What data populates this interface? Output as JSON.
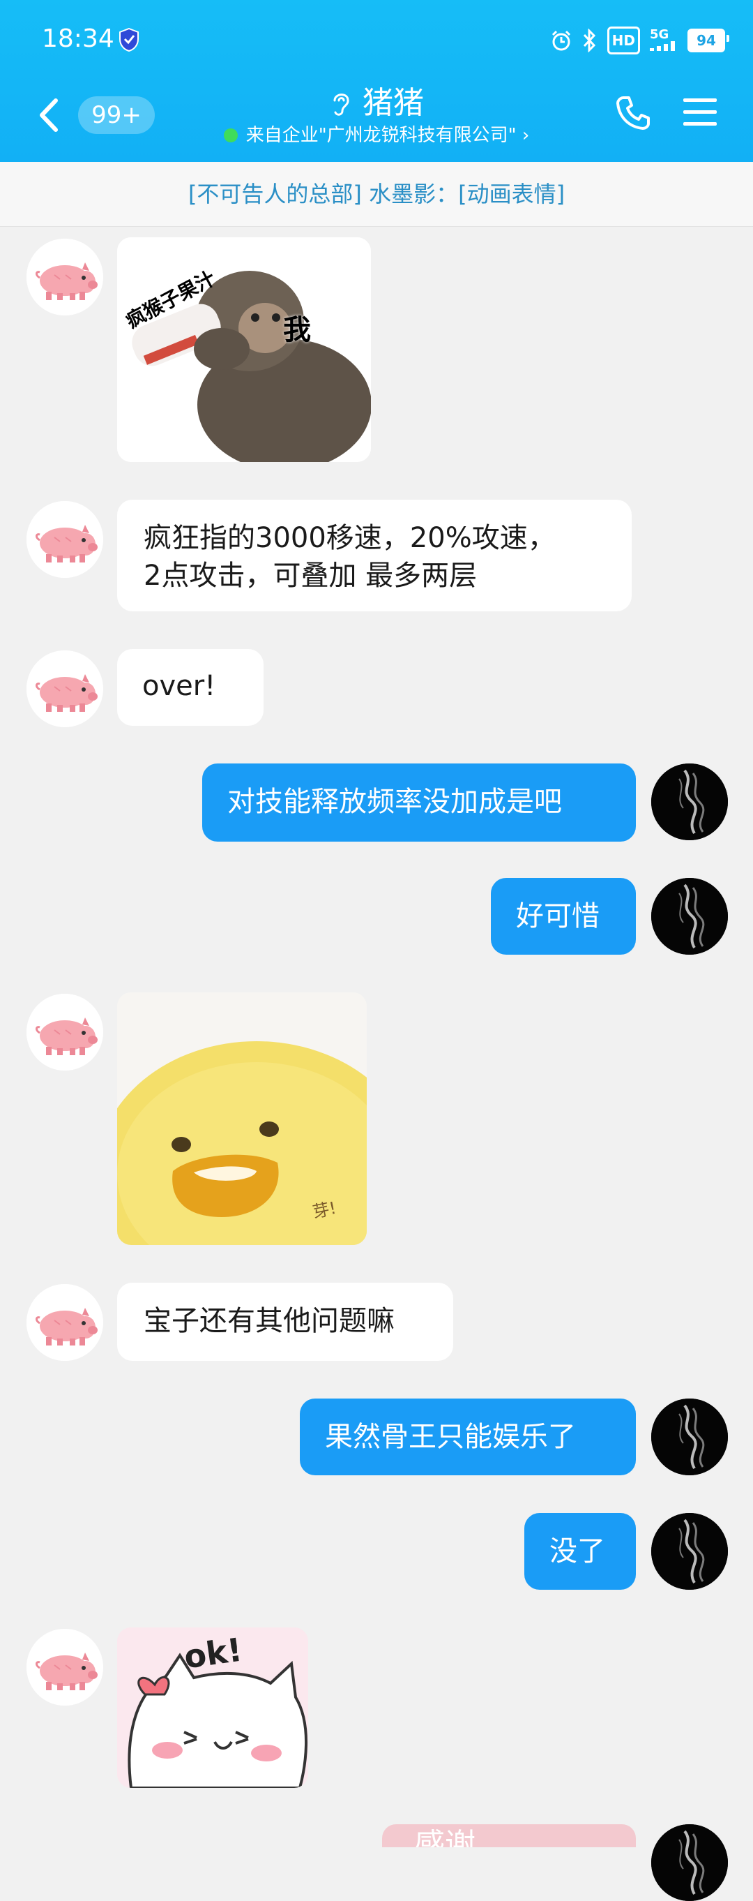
{
  "status_bar": {
    "time": "18:34",
    "network": "5G",
    "hd": "HD",
    "battery": "94"
  },
  "header": {
    "unread_count": "99+",
    "title": "猪猪",
    "subtitle": "来自企业\"广州龙锐科技有限公司\" ›"
  },
  "notice": "[不可告人的总部] 水墨影：[动画表情]",
  "messages": [
    {
      "id": 1,
      "side": "in",
      "type": "sticker",
      "sticker_text_1": "疯猴子果汁",
      "sticker_text_2": "我"
    },
    {
      "id": 2,
      "side": "in",
      "type": "text",
      "text_line1": "疯狂指的3000移速，20%攻速，",
      "text_line2": "2点攻击，可叠加 最多两层"
    },
    {
      "id": 3,
      "side": "in",
      "type": "text",
      "text": "over!"
    },
    {
      "id": 4,
      "side": "out",
      "type": "text",
      "text": "对技能释放频率没加成是吧"
    },
    {
      "id": 5,
      "side": "out",
      "type": "text",
      "text": "好可惜"
    },
    {
      "id": 6,
      "side": "in",
      "type": "sticker",
      "sticker_text": "芽!"
    },
    {
      "id": 7,
      "side": "in",
      "type": "text",
      "text": "宝子还有其他问题嘛"
    },
    {
      "id": 8,
      "side": "out",
      "type": "text",
      "text": "果然骨王只能娱乐了"
    },
    {
      "id": 9,
      "side": "out",
      "type": "text",
      "text": "没了"
    },
    {
      "id": 10,
      "side": "in",
      "type": "sticker",
      "sticker_text": "ok!"
    },
    {
      "id": 11,
      "side": "out",
      "type": "sticker",
      "sticker_text": "感谢"
    }
  ],
  "colors": {
    "header": "#16bdf7",
    "outgoing_bubble": "#1a9cf6",
    "incoming_bubble": "#ffffff",
    "background": "#f1f1f1",
    "notice_text": "#2a8fc6"
  },
  "icons": [
    "back-icon",
    "ear-icon",
    "phone-icon",
    "menu-icon",
    "pig-avatar-icon",
    "smoke-avatar-icon"
  ]
}
